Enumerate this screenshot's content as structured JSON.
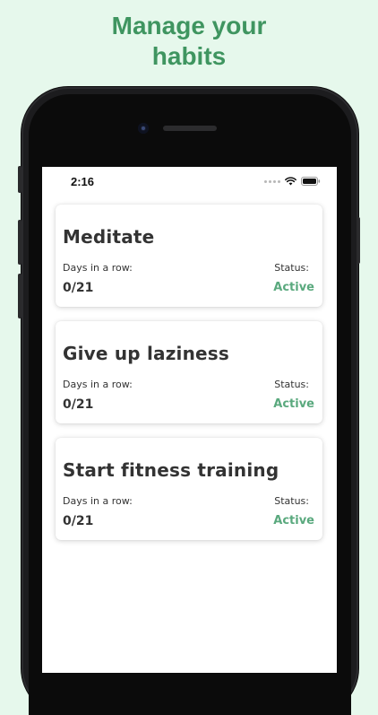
{
  "headline": {
    "line1": "Manage your",
    "line2": "habits"
  },
  "status_bar": {
    "time": "2:16",
    "icons": [
      "signal-dots-icon",
      "wifi-icon",
      "battery-icon"
    ]
  },
  "habits": [
    {
      "title": "Meditate",
      "streak_label": "Days in a row:",
      "streak_value": "0/21",
      "status_label": "Status:",
      "status_value": "Active"
    },
    {
      "title": "Give up laziness",
      "streak_label": "Days in a row:",
      "streak_value": "0/21",
      "status_label": "Status:",
      "status_value": "Active"
    },
    {
      "title": "Start fitness training",
      "streak_label": "Days in a row:",
      "streak_value": "0/21",
      "status_label": "Status:",
      "status_value": "Active"
    }
  ],
  "colors": {
    "background": "#e6f8ec",
    "headline": "#3f9560",
    "active_status": "#5aa97e"
  }
}
